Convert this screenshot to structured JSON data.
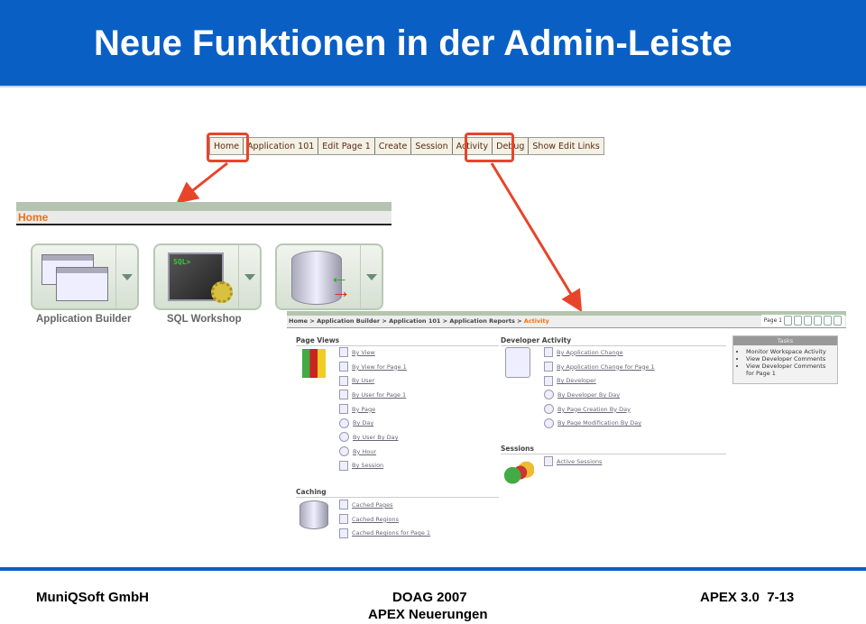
{
  "slide_title": "Neue Funktionen in der Admin-Leiste",
  "admin_bar": {
    "tabs": [
      "Home",
      "Application 101",
      "Edit Page 1",
      "Create",
      "Session",
      "Activity",
      "Debug",
      "Show Edit Links"
    ]
  },
  "home_screen": {
    "header": "Home",
    "tiles": [
      {
        "label": "Application Builder"
      },
      {
        "label": "SQL Workshop",
        "screen_text": "SQL>"
      },
      {
        "label": ""
      }
    ]
  },
  "activity_screen": {
    "breadcrumb": [
      "Home",
      "Application Builder",
      "Application 101",
      "Application Reports"
    ],
    "breadcrumb_current": "Activity",
    "page_indicator": "Page 1",
    "page_views": {
      "title": "Page Views",
      "links": [
        "By View",
        "By View for Page 1",
        "By User",
        "By User for Page 1",
        "By Page",
        "By Day",
        "By User By Day",
        "By Hour",
        "By Session"
      ]
    },
    "developer_activity": {
      "title": "Developer Activity",
      "links": [
        "By Application Change",
        "By Application Change for Page 1",
        "By Developer",
        "By Developer By Day",
        "By Page Creation By Day",
        "By Page Modification By Day"
      ]
    },
    "sessions": {
      "title": "Sessions",
      "links": [
        "Active Sessions"
      ]
    },
    "caching": {
      "title": "Caching",
      "links": [
        "Cached Pages",
        "Cached Regions",
        "Cached Regions for Page 1"
      ]
    },
    "tasks": {
      "title": "Tasks",
      "items": [
        "Monitor Workspace Activity",
        "View Developer Comments",
        "View Developer Comments for Page 1"
      ]
    }
  },
  "footer": {
    "company": "MuniQSoft GmbH",
    "event": "DOAG 2007",
    "subtitle": "APEX Neuerungen",
    "page": "APEX 3.0  7-13"
  },
  "colors": {
    "title_bar": "#0a5fc4",
    "highlight": "#e8442a",
    "current_crumb": "#f07010"
  }
}
